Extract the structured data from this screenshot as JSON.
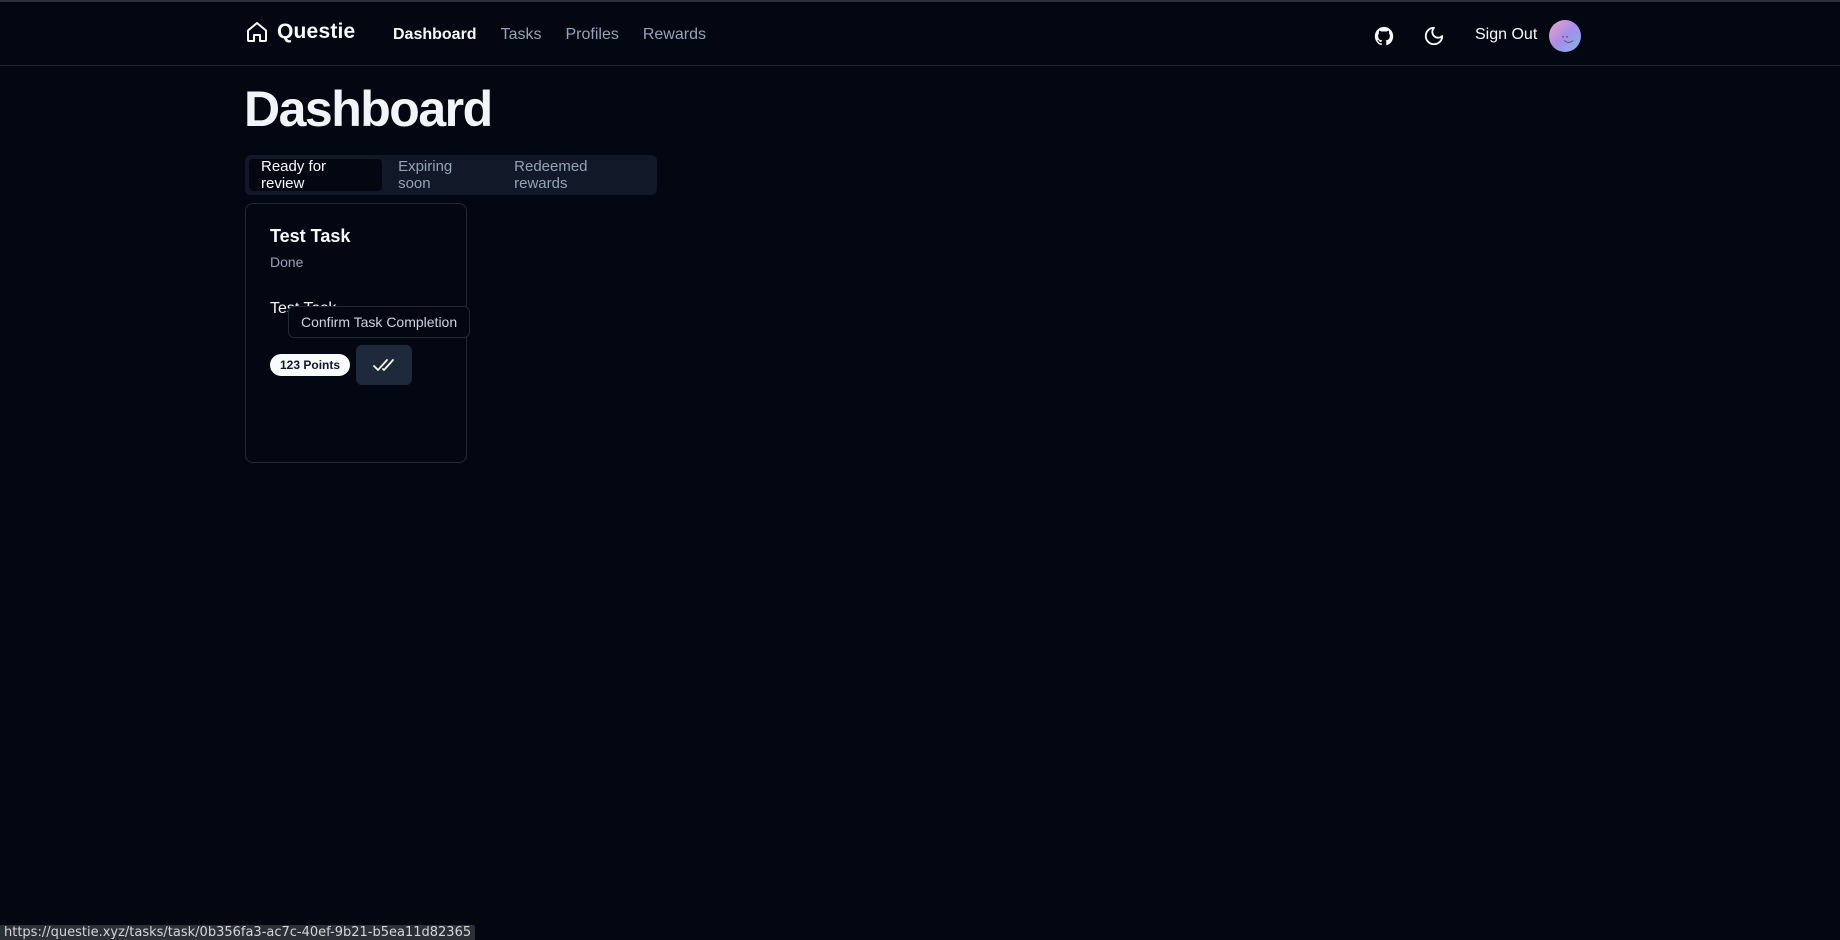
{
  "app": {
    "name": "Questie"
  },
  "nav": {
    "items": [
      {
        "label": "Dashboard",
        "active": true
      },
      {
        "label": "Tasks",
        "active": false
      },
      {
        "label": "Profiles",
        "active": false
      },
      {
        "label": "Rewards",
        "active": false
      }
    ]
  },
  "header": {
    "sign_out_label": "Sign Out",
    "icons": [
      "github-icon",
      "moon-icon",
      "avatar"
    ]
  },
  "page": {
    "title": "Dashboard"
  },
  "tabs": [
    {
      "label": "Ready for review",
      "active": true
    },
    {
      "label": "Expiring soon",
      "active": false
    },
    {
      "label": "Redeemed rewards",
      "active": false
    }
  ],
  "task_card": {
    "title": "Test Task",
    "status": "Done",
    "description": "Test Task",
    "points": "123 Points",
    "confirm_tooltip": "Confirm Task Completion"
  },
  "status_bar": {
    "url": "https://questie.xyz/tasks/task/0b356fa3-ac7c-40ef-9b21-b5ea11d82365"
  },
  "colors": {
    "background": "#030712",
    "card_border": "#1f2937",
    "tab_bg": "#111827",
    "muted_text": "#94a3b8",
    "primary_text": "#f8fafc"
  }
}
